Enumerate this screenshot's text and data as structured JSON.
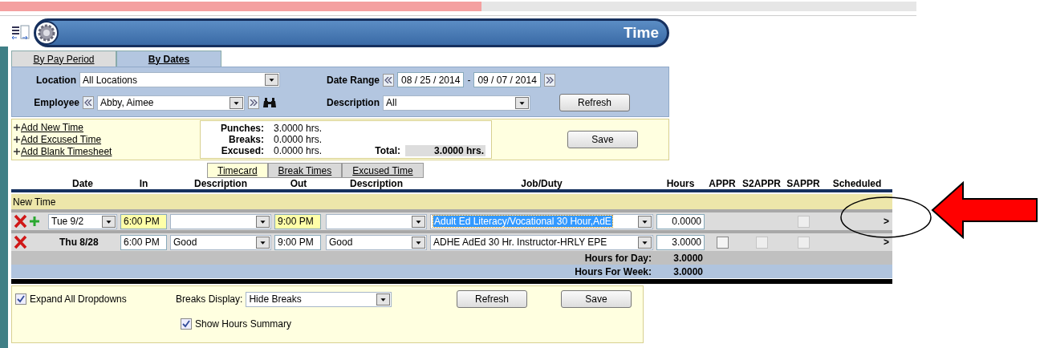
{
  "header": {
    "title": "Time"
  },
  "view_tabs": [
    {
      "label": "By Pay Period",
      "selected": false
    },
    {
      "label": "By Dates",
      "selected": true
    }
  ],
  "filters": {
    "location": {
      "label": "Location",
      "value": "All Locations"
    },
    "employee": {
      "label": "Employee",
      "value": "Abby, Aimee"
    },
    "date_range": {
      "label": "Date Range",
      "start": "08 / 25 / 2014",
      "separator": "-",
      "end": "09 / 07 / 2014"
    },
    "description": {
      "label": "Description",
      "value": "All"
    },
    "refresh_button": "Refresh"
  },
  "actions": {
    "links": [
      "Add New Time",
      "Add Excused Time",
      "Add Blank Timesheet"
    ],
    "summary": [
      {
        "label": "Punches:",
        "value": "3.0000 hrs."
      },
      {
        "label": "Breaks:",
        "value": "0.0000 hrs."
      },
      {
        "label": "Excused:",
        "value": "0.0000 hrs."
      }
    ],
    "total": {
      "label": "Total:",
      "value": "3.0000 hrs."
    },
    "save_button": "Save"
  },
  "sub_tabs": [
    {
      "label": "Timecard",
      "selected": true
    },
    {
      "label": "Break Times",
      "selected": false
    },
    {
      "label": "Excused Time",
      "selected": false
    }
  ],
  "columns": [
    "Date",
    "In",
    "Description",
    "Out",
    "Description",
    "Job/Duty",
    "Hours",
    "APPR",
    "S2APPR",
    "SAPPR",
    "Scheduled"
  ],
  "section_label": "New Time",
  "rows": [
    {
      "kind": "new",
      "date": "Tue 9/2",
      "in": "6:00 PM",
      "out": "9:00 PM",
      "job": "Adult Ed Literacy/Vocational 30 Hour,AdE",
      "job_selected": true,
      "hours": "0.0000",
      "sappr": {
        "checked": false,
        "disabled": true
      },
      "scheduled": ">"
    },
    {
      "kind": "existing",
      "date": "Thu 8/28",
      "in": "6:00 PM",
      "in_description": "Good",
      "out": "9:00 PM",
      "out_description": "Good",
      "job": "ADHE AdEd 30 Hr. Instructor-HRLY EPE",
      "job_selected": false,
      "hours": "3.0000",
      "appr": {
        "checked": false,
        "disabled": false
      },
      "s2appr": {
        "checked": false,
        "disabled": true
      },
      "sappr": {
        "checked": false,
        "disabled": true
      },
      "scheduled": ">"
    }
  ],
  "totals": [
    {
      "kind": "day",
      "label": "Hours for Day:",
      "value": "3.0000"
    },
    {
      "kind": "week",
      "label": "Hours For Week:",
      "value": "3.0000"
    }
  ],
  "footer": {
    "expand_all": {
      "label": "Expand All Dropdowns",
      "checked": true
    },
    "breaks_display": {
      "label": "Breaks Display:",
      "value": "Hide Breaks"
    },
    "refresh_button": "Refresh",
    "save_button": "Save",
    "show_summary": {
      "label": "Show Hours Summary",
      "checked": true
    }
  }
}
